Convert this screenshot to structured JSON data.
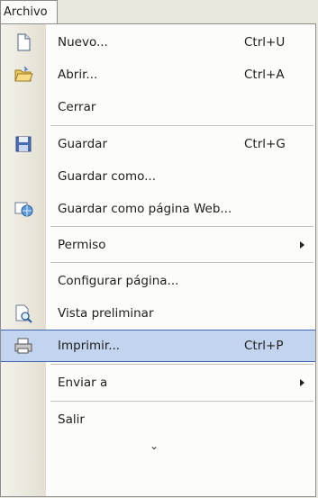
{
  "menubar": {
    "tab_label": "Archivo"
  },
  "menu": {
    "items": [
      {
        "label": "Nuevo...",
        "shortcut": "Ctrl+U"
      },
      {
        "label": "Abrir...",
        "shortcut": "Ctrl+A"
      },
      {
        "label": "Cerrar"
      },
      {
        "label": "Guardar",
        "shortcut": "Ctrl+G"
      },
      {
        "label": "Guardar como..."
      },
      {
        "label": "Guardar como página Web..."
      },
      {
        "label": "Permiso"
      },
      {
        "label": "Configurar página..."
      },
      {
        "label": "Vista preliminar"
      },
      {
        "label": "Imprimir...",
        "shortcut": "Ctrl+P"
      },
      {
        "label": "Enviar a"
      },
      {
        "label": "Salir"
      }
    ],
    "expand_glyph": "⌄",
    "highlight_color": "#c3d5ee",
    "highlight_border": "#3e69b2"
  }
}
